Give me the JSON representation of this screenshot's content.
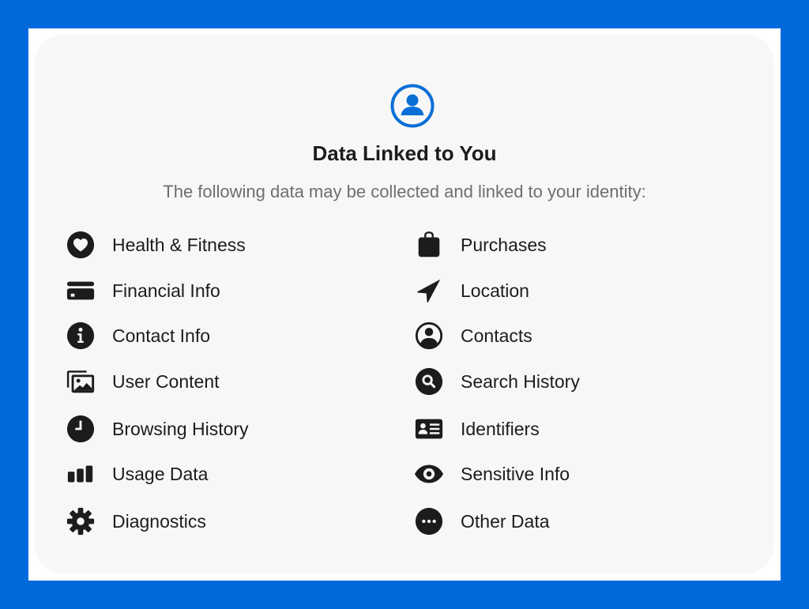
{
  "colors": {
    "background": "#006ADC",
    "card": "#f7f7f7",
    "accent": "#0A6FD6",
    "text": "#1c1c1e",
    "secondary_text": "#6e6e73"
  },
  "header": {
    "icon": "person-circle-icon",
    "title": "Data Linked to You",
    "subtitle": "The following data may be collected and linked to your identity:"
  },
  "left_column": [
    {
      "icon": "heart-icon",
      "label": "Health & Fitness"
    },
    {
      "icon": "credit-card-icon",
      "label": "Financial Info"
    },
    {
      "icon": "info-icon",
      "label": "Contact Info"
    },
    {
      "icon": "photos-icon",
      "label": "User Content"
    },
    {
      "icon": "clock-icon",
      "label": "Browsing History"
    },
    {
      "icon": "bar-chart-icon",
      "label": "Usage Data"
    },
    {
      "icon": "gear-icon",
      "label": "Diagnostics"
    }
  ],
  "right_column": [
    {
      "icon": "shopping-bag-icon",
      "label": "Purchases"
    },
    {
      "icon": "location-arrow-icon",
      "label": "Location"
    },
    {
      "icon": "person-circle-icon",
      "label": "Contacts"
    },
    {
      "icon": "search-icon",
      "label": "Search History"
    },
    {
      "icon": "id-card-icon",
      "label": "Identifiers"
    },
    {
      "icon": "eye-icon",
      "label": "Sensitive Info"
    },
    {
      "icon": "ellipsis-circle-icon",
      "label": "Other Data"
    }
  ]
}
